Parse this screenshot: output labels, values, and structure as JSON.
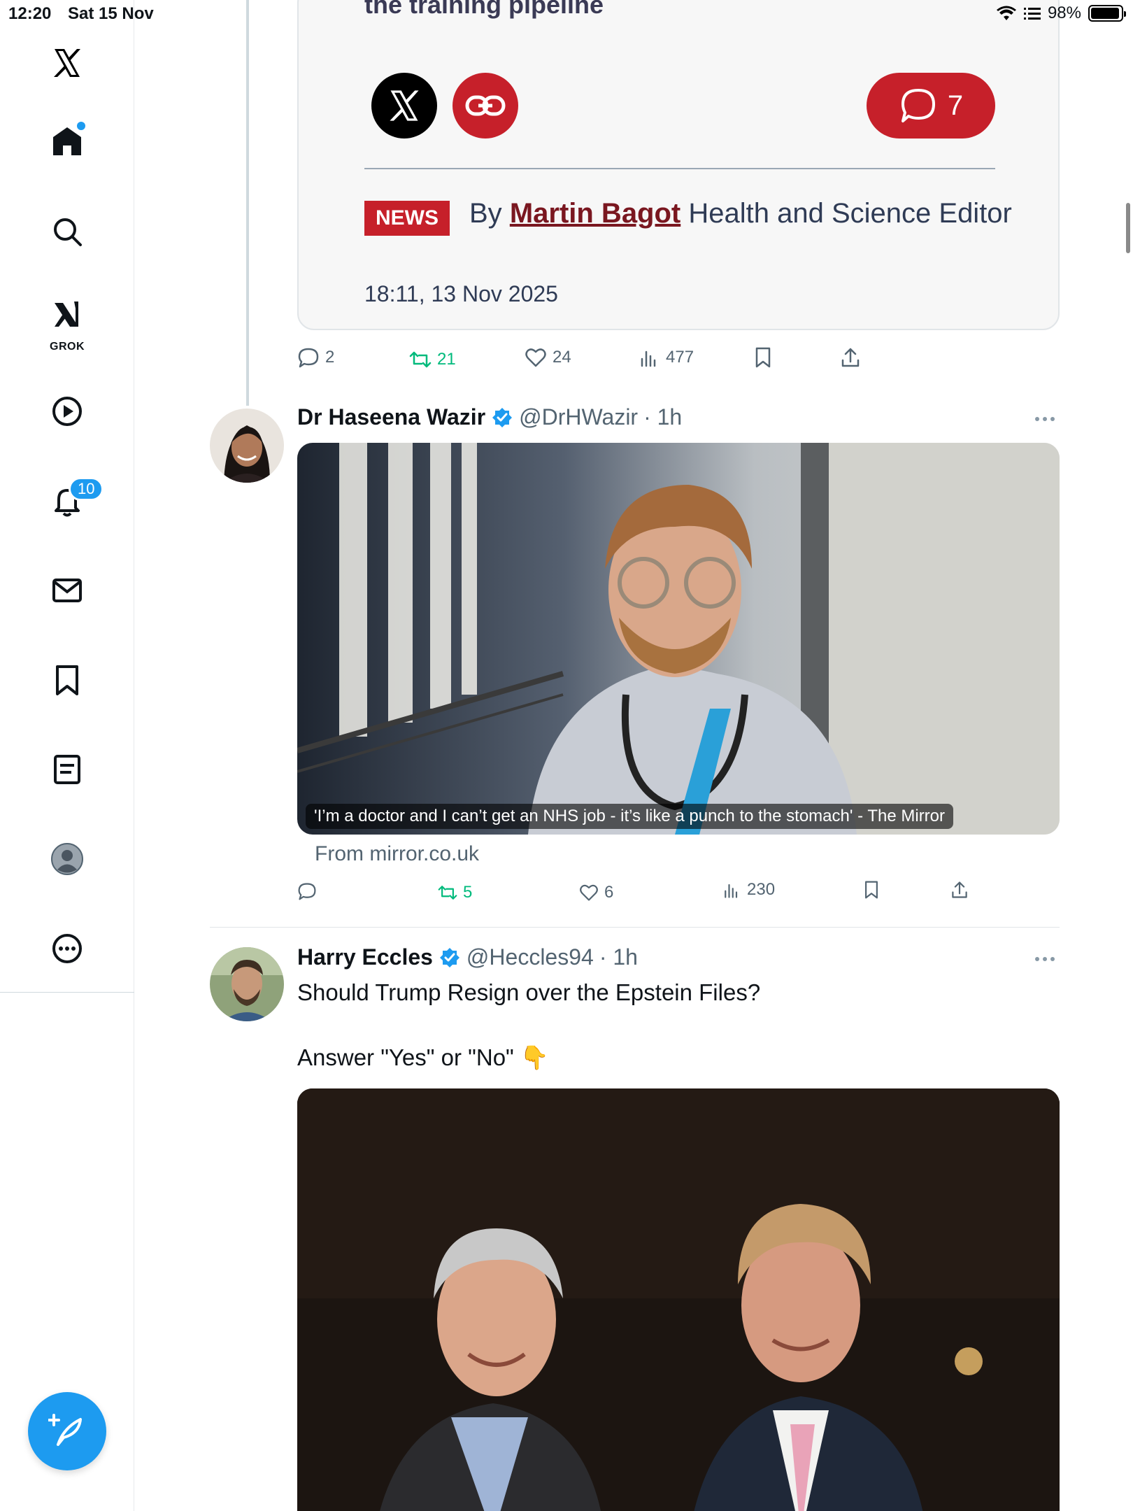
{
  "status_bar": {
    "time": "12:20",
    "date": "Sat 15 Nov",
    "battery": "98%"
  },
  "sidebar": {
    "logo_icon": "x-logo-icon",
    "items": [
      {
        "name": "home",
        "icon": "home-icon"
      },
      {
        "name": "explore",
        "icon": "search-icon"
      },
      {
        "name": "grok",
        "icon": "grok-icon",
        "label": "GROK"
      },
      {
        "name": "video",
        "icon": "play-icon"
      },
      {
        "name": "notifications",
        "icon": "bell-icon",
        "badge": "10"
      },
      {
        "name": "messages",
        "icon": "mail-icon"
      },
      {
        "name": "bookmarks",
        "icon": "bookmark-icon"
      },
      {
        "name": "lists",
        "icon": "list-icon"
      },
      {
        "name": "profile",
        "icon": "profile-icon"
      },
      {
        "name": "more",
        "icon": "more-icon"
      }
    ],
    "compose_icon": "compose-icon"
  },
  "article_card": {
    "headline": "the training pipeline",
    "comment_count": "7",
    "news_tag": "NEWS",
    "byline_prefix": "By",
    "author": "Martin Bagot",
    "author_role": "Health and Science Editor",
    "timestamp": "18:11, 13 Nov 2025"
  },
  "tweet1_actions": {
    "replies": "2",
    "retweets": "21",
    "likes": "24",
    "views": "477"
  },
  "tweet2": {
    "name": "Dr Haseena Wazir",
    "handle": "@DrHWazir",
    "time": "· 1h",
    "media_caption": "'I’m a doctor and I can’t get an NHS job - it’s like a punch to the stomach' - The Mirror",
    "from_link": "From mirror.co.uk",
    "actions": {
      "replies": "",
      "retweets": "5",
      "likes": "6",
      "views": "230"
    }
  },
  "tweet3": {
    "name": "Harry Eccles",
    "handle": "@Heccles94",
    "time": "· 1h",
    "text_line1": "Should Trump Resign over the Epstein Files?",
    "text_line2": "Answer \"Yes\" or \"No\"  👇"
  },
  "colors": {
    "accent": "#1d9bf0",
    "retweet_green": "#00ba7c",
    "mirror_red": "#c6202a"
  }
}
